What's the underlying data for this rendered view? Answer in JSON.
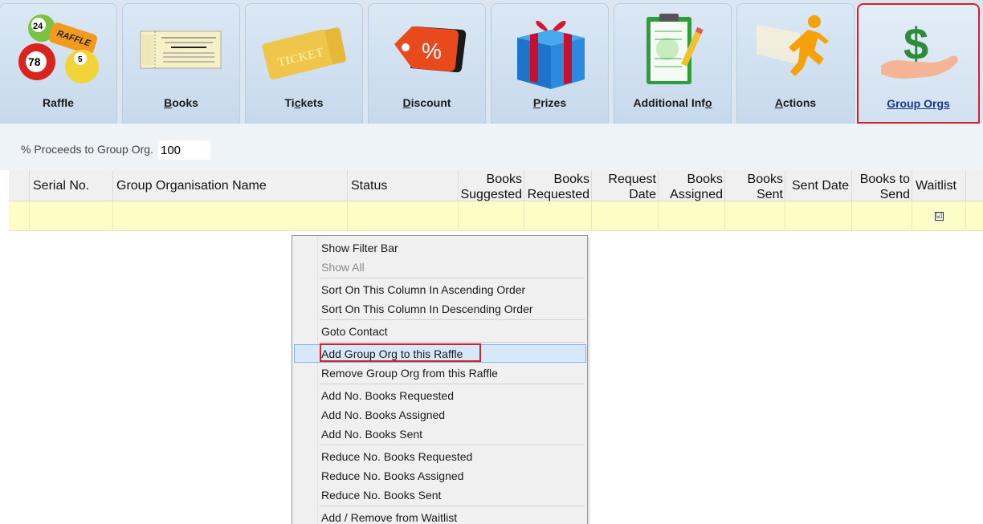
{
  "tabs": [
    {
      "id": "raffle",
      "label": "Raffle",
      "underline": "",
      "icon": "raffle-balls-icon"
    },
    {
      "id": "books",
      "label": "Books",
      "underline": "B",
      "icon": "raffle-book-icon"
    },
    {
      "id": "tickets",
      "label": "Tickets",
      "underline": "c",
      "icon": "ticket-icon"
    },
    {
      "id": "discount",
      "label": "Discount",
      "underline": "D",
      "icon": "discount-tag-icon"
    },
    {
      "id": "prizes",
      "label": "Prizes",
      "underline": "P",
      "icon": "gift-box-icon"
    },
    {
      "id": "additional",
      "label": "Additional Info",
      "underline": "",
      "icon": "clipboard-icon"
    },
    {
      "id": "actions",
      "label": "Actions",
      "underline": "A",
      "icon": "running-man-icon"
    },
    {
      "id": "grouporgs",
      "label": "Group Orgs",
      "underline": "",
      "icon": "money-hand-icon",
      "active": true
    }
  ],
  "tab_labels": {
    "raffle": "Raffle",
    "books_first": "B",
    "books_rest": "ooks",
    "tickets_a": "Ti",
    "tickets_ul": "c",
    "tickets_b": "kets",
    "discount_first": "D",
    "discount_rest": "iscount",
    "prizes_first": "P",
    "prizes_rest": "rizes",
    "additional_a": "Additional Inf",
    "additional_ul": "o",
    "actions_first": "A",
    "actions_rest": "ctions",
    "grouporgs": "Group Orgs"
  },
  "proceeds": {
    "label": "% Proceeds to Group Org.",
    "value": "100"
  },
  "grid": {
    "columns": {
      "serial": "Serial No.",
      "name": "Group Organisation Name",
      "status": "Status",
      "books_suggested_1": "Books",
      "books_suggested_2": "Suggested",
      "books_requested_1": "Books",
      "books_requested_2": "Requested",
      "request_date_1": "Request",
      "request_date_2": "Date",
      "books_assigned_1": "Books",
      "books_assigned_2": "Assigned",
      "books_sent_1": "Books",
      "books_sent_2": "Sent",
      "sent_date": "Sent Date",
      "books_to_send_1": "Books to",
      "books_to_send_2": "Send",
      "waitlist": "Waitlist"
    },
    "row": {
      "waitlist_mark": "☑"
    }
  },
  "context_menu": {
    "show_filter_bar": "Show Filter Bar",
    "show_all": "Show All",
    "sort_asc": "Sort On This Column In Ascending Order",
    "sort_desc": "Sort On This Column In Descending Order",
    "goto_contact": "Goto Contact",
    "add_group_org": "Add Group Org to this Raffle",
    "remove_group_org": "Remove Group Org from this Raffle",
    "add_requested": "Add No. Books Requested",
    "add_assigned": "Add No. Books Assigned",
    "add_sent": "Add No. Books Sent",
    "reduce_requested": "Reduce No. Books Requested",
    "reduce_assigned": "Reduce No. Books Assigned",
    "reduce_sent": "Reduce No. Books Sent",
    "waitlist": "Add / Remove from Waitlist"
  },
  "colors": {
    "highlight_border": "#d2232a",
    "active_tab_text": "#17388a",
    "row_bg": "#fdfdc8"
  }
}
